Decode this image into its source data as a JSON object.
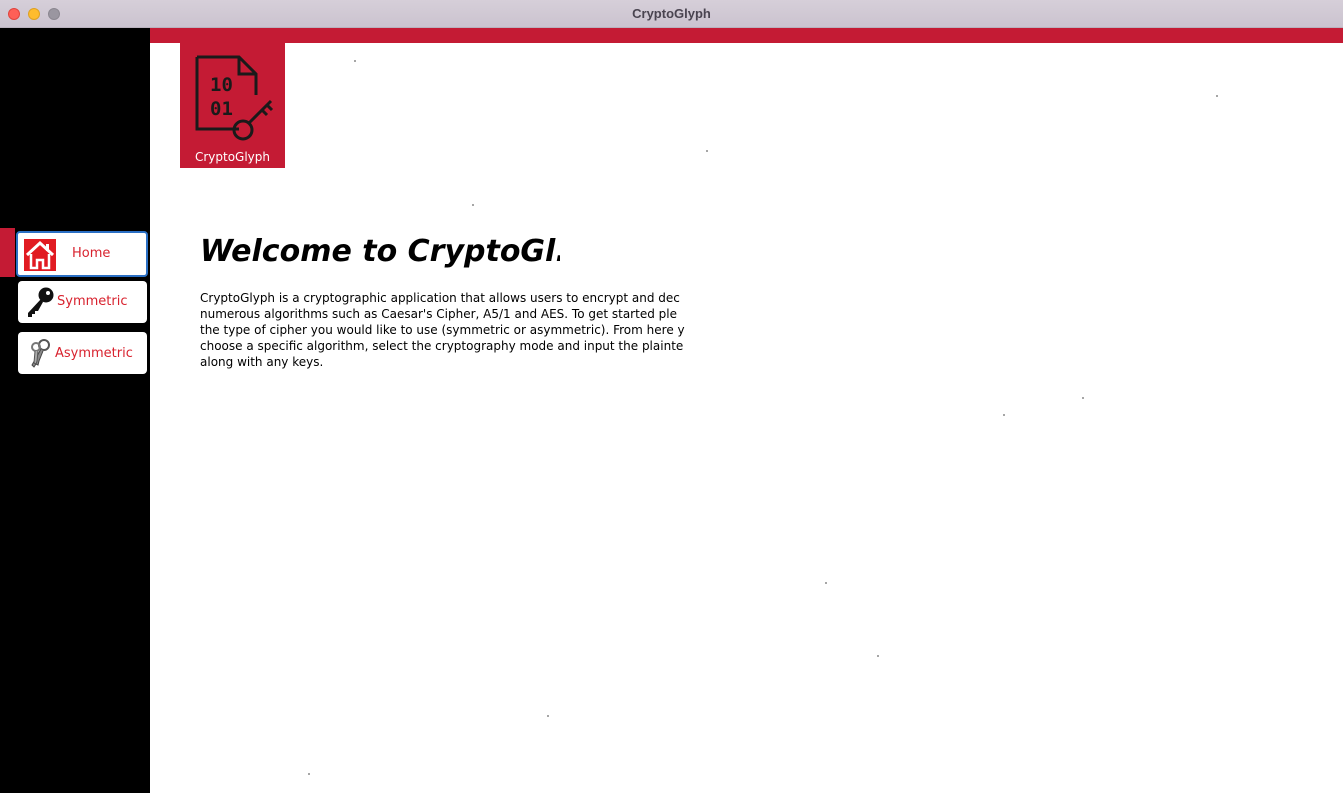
{
  "window": {
    "title": "CryptoGlyph"
  },
  "logo": {
    "text": "CryptoGlyph",
    "icon": "binary-file-key-icon",
    "digits_top": "10",
    "digits_bottom": "01"
  },
  "sidebar": {
    "items": [
      {
        "label": "Home",
        "icon": "home-icon",
        "active": true
      },
      {
        "label": "Symmetric",
        "icon": "key-icon",
        "active": false
      },
      {
        "label": "Asymmetric",
        "icon": "keys-pair-icon",
        "active": false
      }
    ]
  },
  "main": {
    "heading": "Welcome to CryptoGl...",
    "description_lines": [
      "CryptoGlyph is a cryptographic application that allows users to encrypt and dec",
      "numerous algorithms such as Caesar's Cipher, A5/1 and AES. To get started ple",
      "the type of cipher you would like to use (symmetric or asymmetric). From here y",
      "choose a specific algorithm, select the cryptography mode and input the plainte",
      "along with any keys."
    ]
  },
  "colors": {
    "accent": "#c41b34",
    "sidebar_bg": "#000000",
    "nav_text": "#d8222e",
    "focus": "#2a6fc4"
  }
}
